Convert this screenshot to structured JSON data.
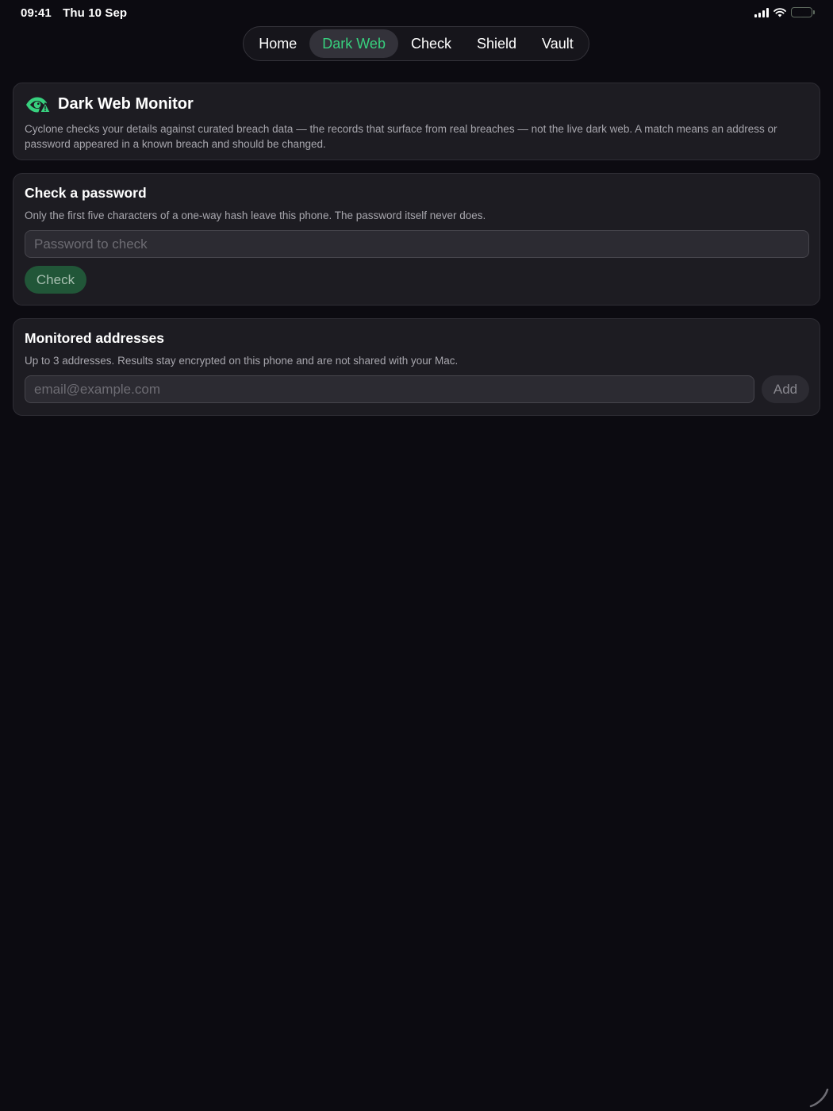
{
  "status_bar": {
    "time": "09:41",
    "date": "Thu 10 Sep",
    "battery_color": "#3ecf5e"
  },
  "nav": {
    "tabs": [
      {
        "label": "Home",
        "active": false
      },
      {
        "label": "Dark Web",
        "active": true
      },
      {
        "label": "Check",
        "active": false
      },
      {
        "label": "Shield",
        "active": false
      },
      {
        "label": "Vault",
        "active": false
      }
    ],
    "active_color": "#37d07e"
  },
  "monitor": {
    "icon": "eye-warning-icon",
    "title": "Dark Web Monitor",
    "description": "Cyclone checks your details against curated breach data — the records that surface from real breaches — not the live dark web. A match means an address or password appeared in a known breach and should be changed."
  },
  "password_check": {
    "title": "Check a password",
    "description": "Only the first five characters of a one-way hash leave this phone. The password itself never does.",
    "input_value": "",
    "input_placeholder": "Password to check",
    "button_label": "Check"
  },
  "addresses": {
    "title": "Monitored addresses",
    "description": "Up to 3 addresses. Results stay encrypted on this phone and are not shared with your Mac.",
    "input_value": "",
    "input_placeholder": "email@example.com",
    "button_label": "Add"
  },
  "colors": {
    "background": "#0c0b11",
    "card": "#1d1c22",
    "accent_green": "#37d07e",
    "check_button": "#215638"
  }
}
